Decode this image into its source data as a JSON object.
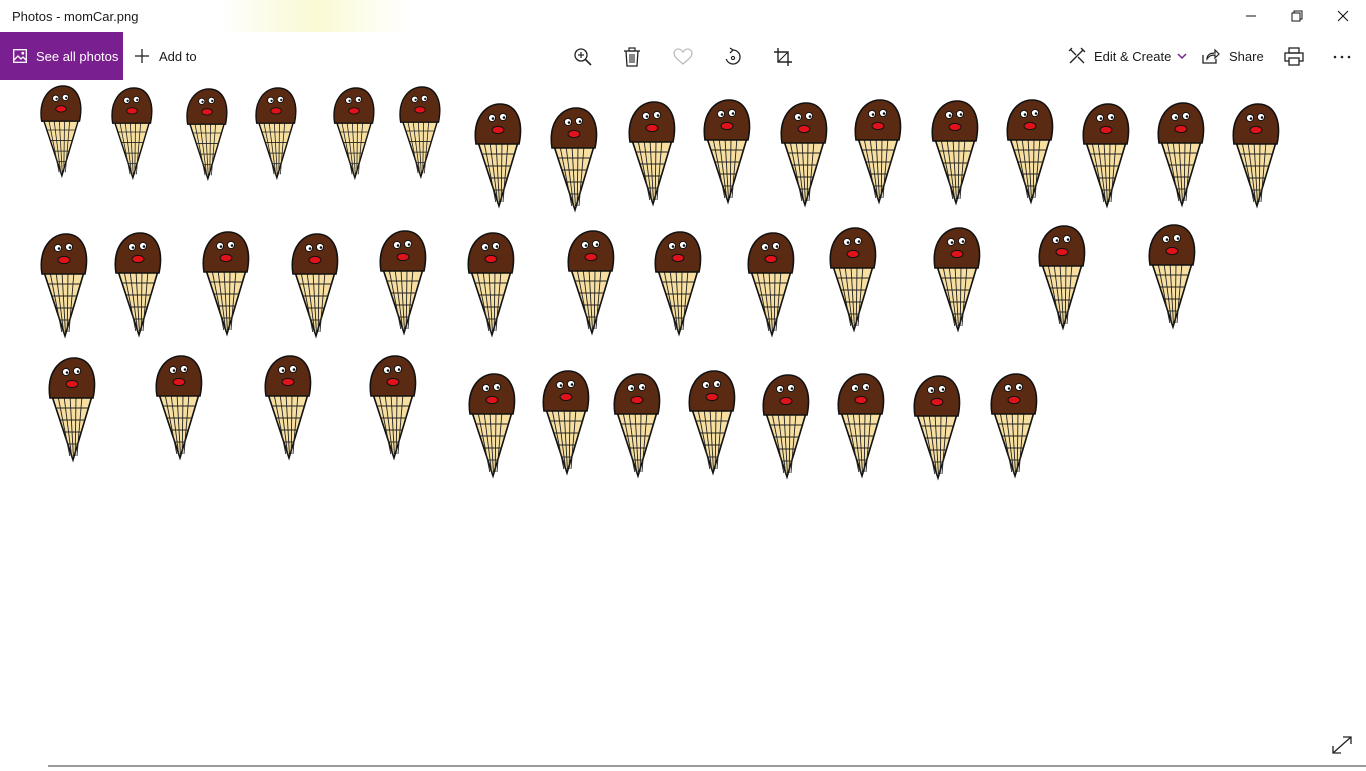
{
  "window": {
    "title": "Photos - momCar.png",
    "controls": [
      "minimize",
      "restore",
      "close"
    ]
  },
  "toolbar": {
    "see_all_label": "See all photos",
    "add_to_label": "Add to",
    "tools": [
      "zoom-in-icon",
      "delete-icon",
      "favorite-icon",
      "rotate-icon",
      "crop-icon"
    ],
    "edit_create_label": "Edit & Create",
    "share_label": "Share",
    "more_label": "···"
  },
  "image": {
    "file_name": "momCar.png",
    "subject": "hand-drawn chocolate ice cream cones with faces",
    "rows": [
      {
        "count": 17
      },
      {
        "count": 13
      },
      {
        "count": 12
      }
    ]
  },
  "colors": {
    "accent": "#7a1f8f",
    "chocolate": "#5a2b12",
    "waffle": "#f6dfa0",
    "mouth": "#e0121a"
  }
}
